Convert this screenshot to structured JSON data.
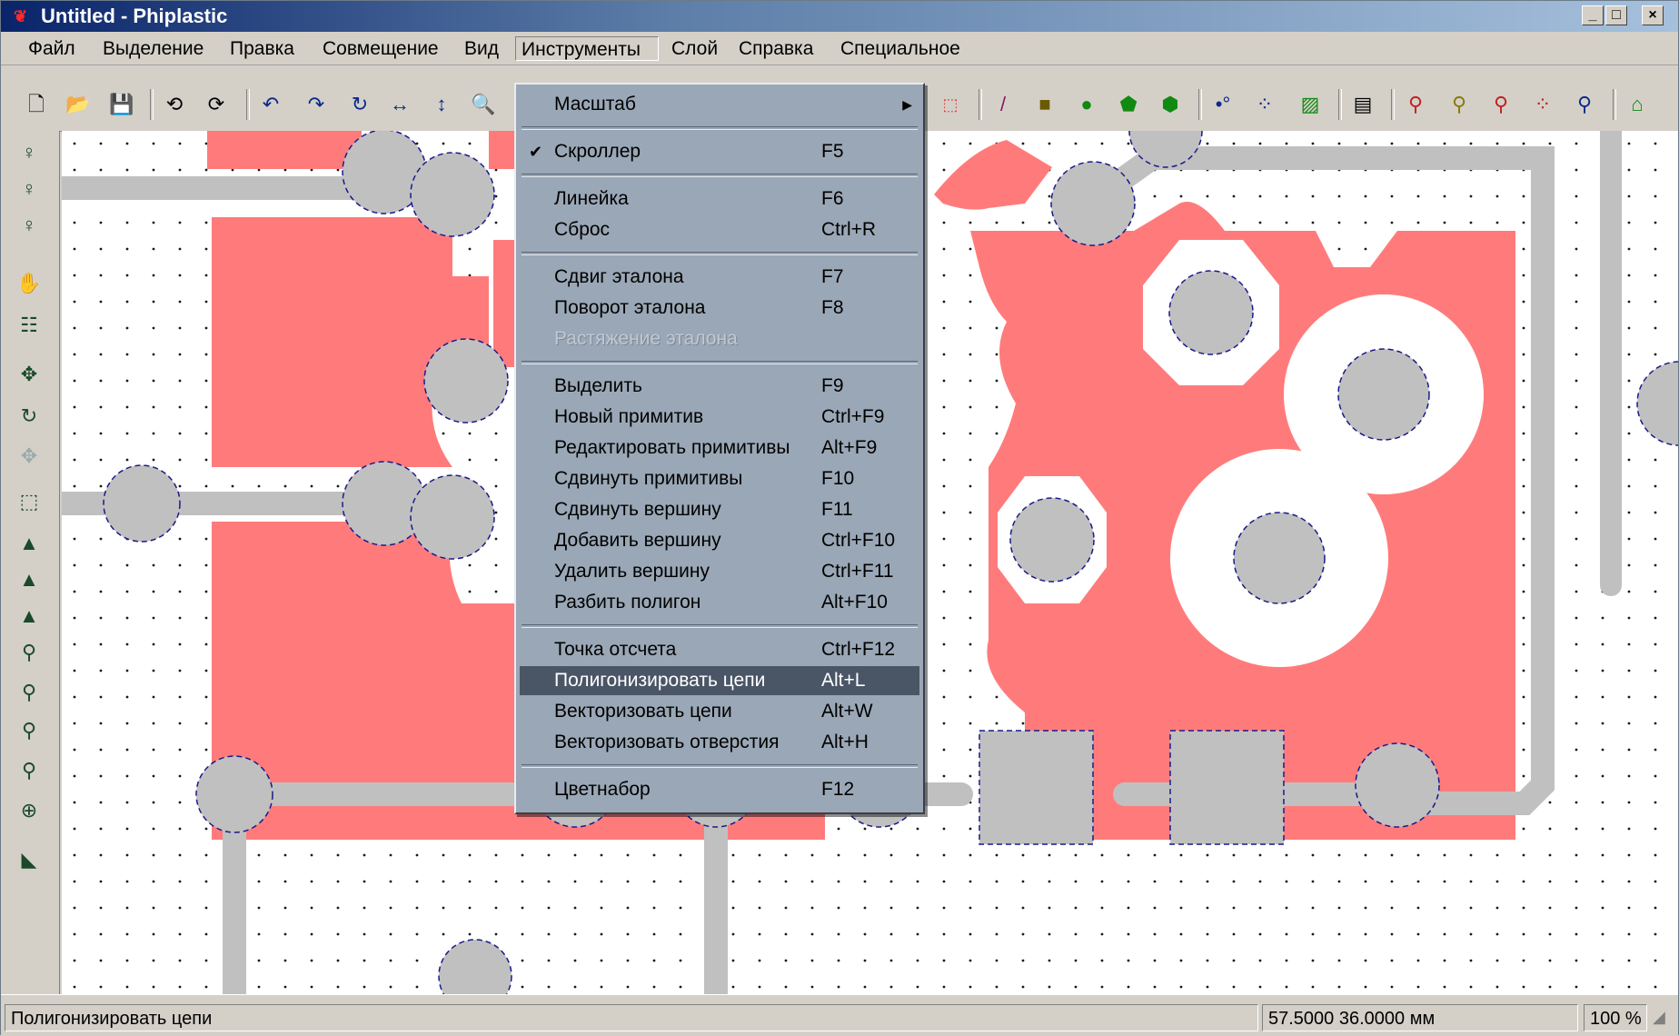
{
  "window": {
    "title": "Untitled - Phiplastic",
    "minimize": "_",
    "maximize": "□",
    "close": "×"
  },
  "menubar": [
    "Файл",
    "Выделение",
    "Правка",
    "Совмещение",
    "Вид",
    "Инструменты",
    "Слой",
    "Справка",
    "Специальное"
  ],
  "active_menu": "Инструменты",
  "tools_menu": {
    "items": [
      {
        "label": "Масштаб",
        "shortcut": "",
        "submenu": true
      },
      {
        "label": "Скроллер",
        "shortcut": "F5",
        "checked": true
      },
      {
        "label": "Линейка",
        "shortcut": "F6"
      },
      {
        "label": "Сброс",
        "shortcut": "Ctrl+R"
      },
      {
        "label": "Сдвиг эталона",
        "shortcut": "F7"
      },
      {
        "label": "Поворот эталона",
        "shortcut": "F8"
      },
      {
        "label": "Растяжение эталона",
        "shortcut": "",
        "disabled": true
      },
      {
        "label": "Выделить",
        "shortcut": "F9"
      },
      {
        "label": "Новый примитив",
        "shortcut": "Ctrl+F9"
      },
      {
        "label": "Редактировать примитивы",
        "shortcut": "Alt+F9"
      },
      {
        "label": "Сдвинуть примитивы",
        "shortcut": "F10"
      },
      {
        "label": "Сдвинуть вершину",
        "shortcut": "F11"
      },
      {
        "label": "Добавить вершину",
        "shortcut": "Ctrl+F10"
      },
      {
        "label": "Удалить вершину",
        "shortcut": "Ctrl+F11"
      },
      {
        "label": "Разбить полигон",
        "shortcut": "Alt+F10"
      },
      {
        "label": "Точка отсчета",
        "shortcut": "Ctrl+F12"
      },
      {
        "label": "Полигонизировать цепи",
        "shortcut": "Alt+L",
        "highlighted": true
      },
      {
        "label": "Векторизовать цепи",
        "shortcut": "Alt+W"
      },
      {
        "label": "Векторизовать отверстия",
        "shortcut": "Alt+H"
      },
      {
        "label": "Цветнабор",
        "shortcut": "F12"
      }
    ]
  },
  "statusbar": {
    "message": "Полигонизировать цепи",
    "coords": "57.5000 36.0000 мм",
    "zoom": "100 %"
  },
  "colors": {
    "copper": "#ff7b7b",
    "track": "#c0c0c0",
    "background": "#ffffff",
    "menu_bg": "#9aa7b6",
    "menu_highlight": "#4a5566"
  }
}
